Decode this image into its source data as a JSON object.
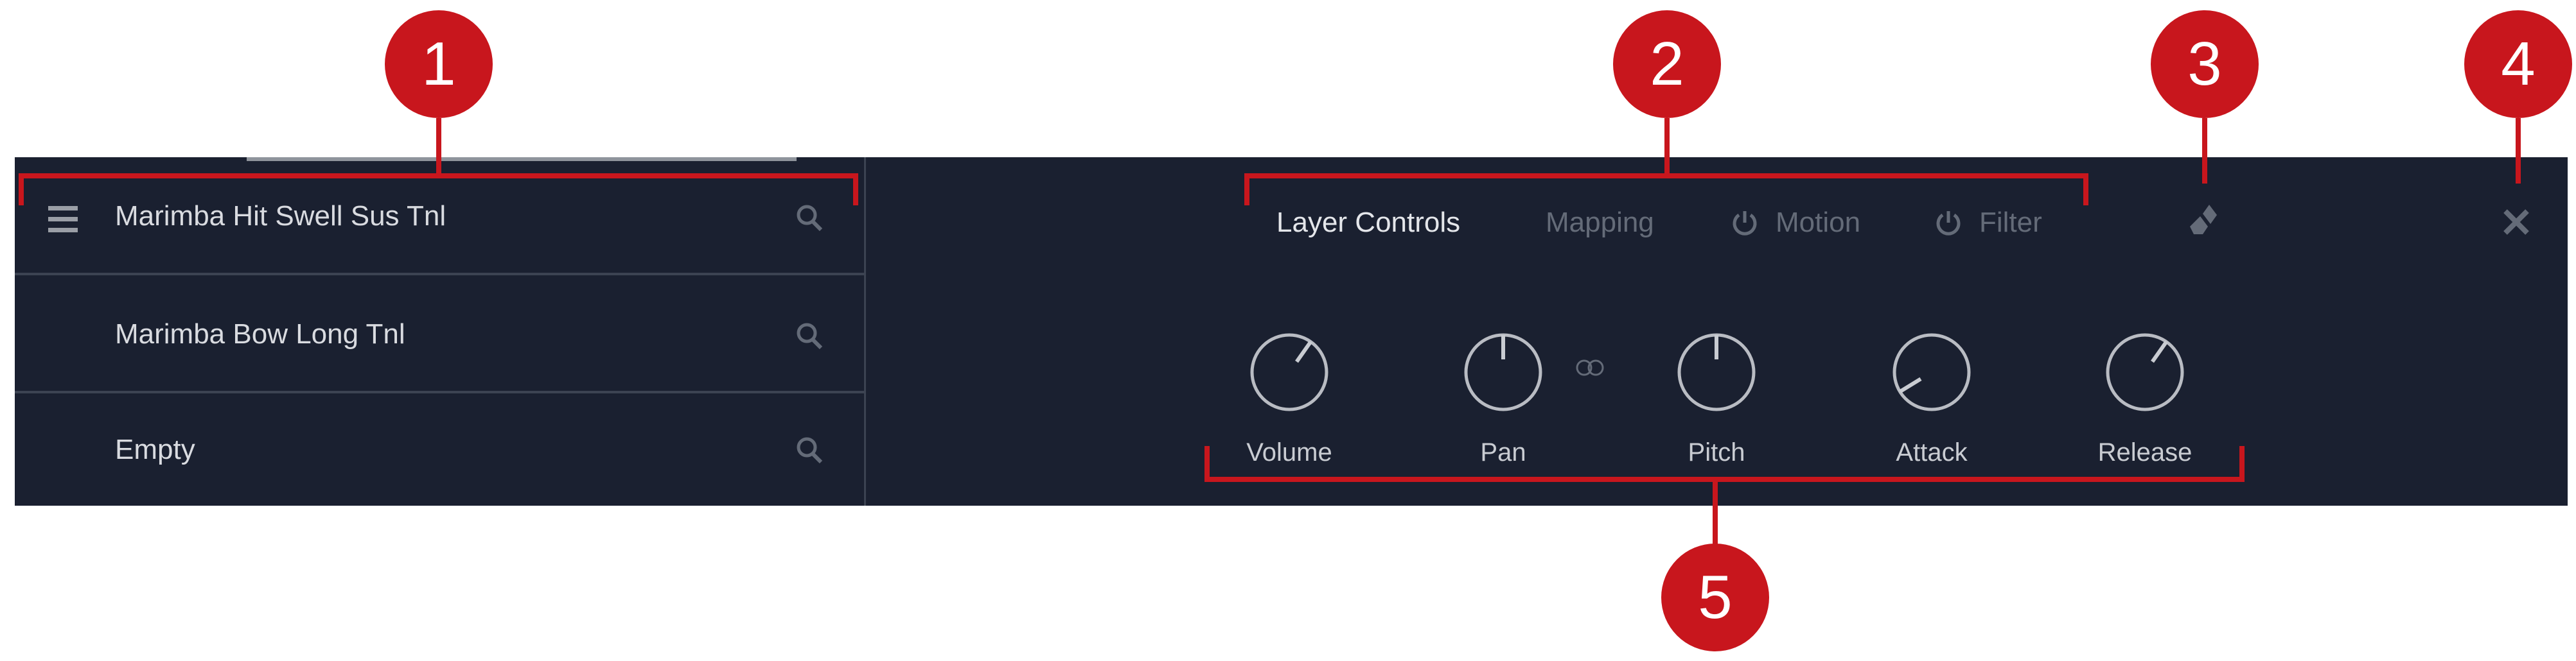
{
  "layers": {
    "menu_icon": "hamburger-icon",
    "items": [
      {
        "label": "Marimba Hit Swell Sus Tnl",
        "icon": "search-icon"
      },
      {
        "label": "Marimba Bow Long Tnl",
        "icon": "search-icon"
      },
      {
        "label": "Empty",
        "icon": "search-icon"
      }
    ]
  },
  "tabs": [
    {
      "label": "Layer Controls",
      "active": true
    },
    {
      "label": "Mapping",
      "active": false
    },
    {
      "label": "Motion",
      "active": false,
      "icon": "power-icon"
    },
    {
      "label": "Filter",
      "active": false,
      "icon": "power-icon"
    }
  ],
  "toolbar": {
    "eraser_icon": "eraser-icon",
    "close_icon": "close-icon"
  },
  "knobs": [
    {
      "label": "Volume",
      "value": 0.63
    },
    {
      "label": "Pan",
      "value": 0.5
    },
    {
      "label": "Pitch",
      "value": 0.5
    },
    {
      "label": "Attack",
      "value": 0.05
    },
    {
      "label": "Release",
      "value": 0.63
    }
  ],
  "link_icon": "link-icon",
  "annotations": [
    "1",
    "2",
    "3",
    "4",
    "5"
  ],
  "colors": {
    "background": "#1a2030",
    "text": "#d9dbe0",
    "dim": "#646b78",
    "annotation": "#c8161d"
  }
}
